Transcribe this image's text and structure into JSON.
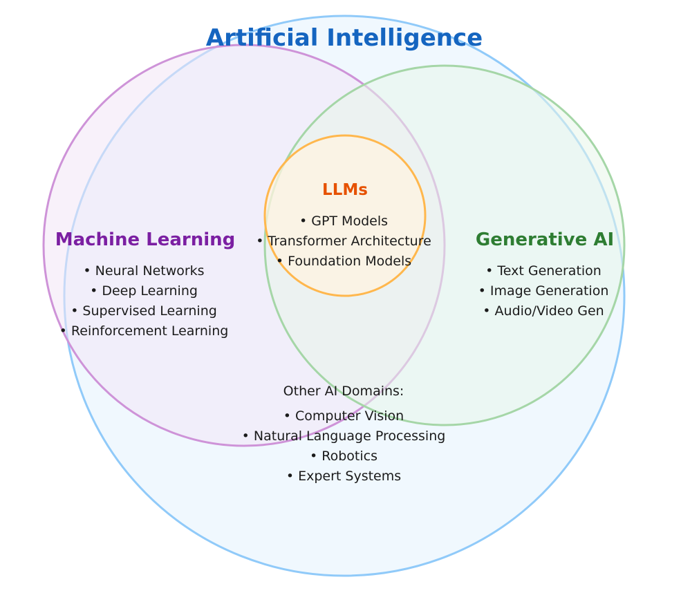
{
  "diagram": {
    "ai": {
      "title": "Artificial Intelligence",
      "color": "#1565c0",
      "fill": "#e3f2fd",
      "stroke": "#90caf9",
      "other_heading": "Other AI Domains:",
      "other_items": [
        "Computer Vision",
        "Natural Language Processing",
        "Robotics",
        "Expert Systems"
      ]
    },
    "ml": {
      "title": "Machine Learning",
      "color": "#7b1fa2",
      "fill": "#f3e5f5",
      "stroke": "#ce93d8",
      "items": [
        "Neural Networks",
        "Deep Learning",
        "Supervised Learning",
        "Reinforcement Learning"
      ]
    },
    "gen": {
      "title": "Generative AI",
      "color": "#2e7d32",
      "fill": "#e8f5e9",
      "stroke": "#a5d6a7",
      "items": [
        "Text Generation",
        "Image Generation",
        "Audio/Video Gen"
      ]
    },
    "llm": {
      "title": "LLMs",
      "color": "#e65100",
      "fill": "#fff3e0",
      "stroke": "#ffb74d",
      "items": [
        "GPT Models",
        "Transformer Architecture",
        "Foundation Models"
      ]
    },
    "bullet": "•"
  }
}
